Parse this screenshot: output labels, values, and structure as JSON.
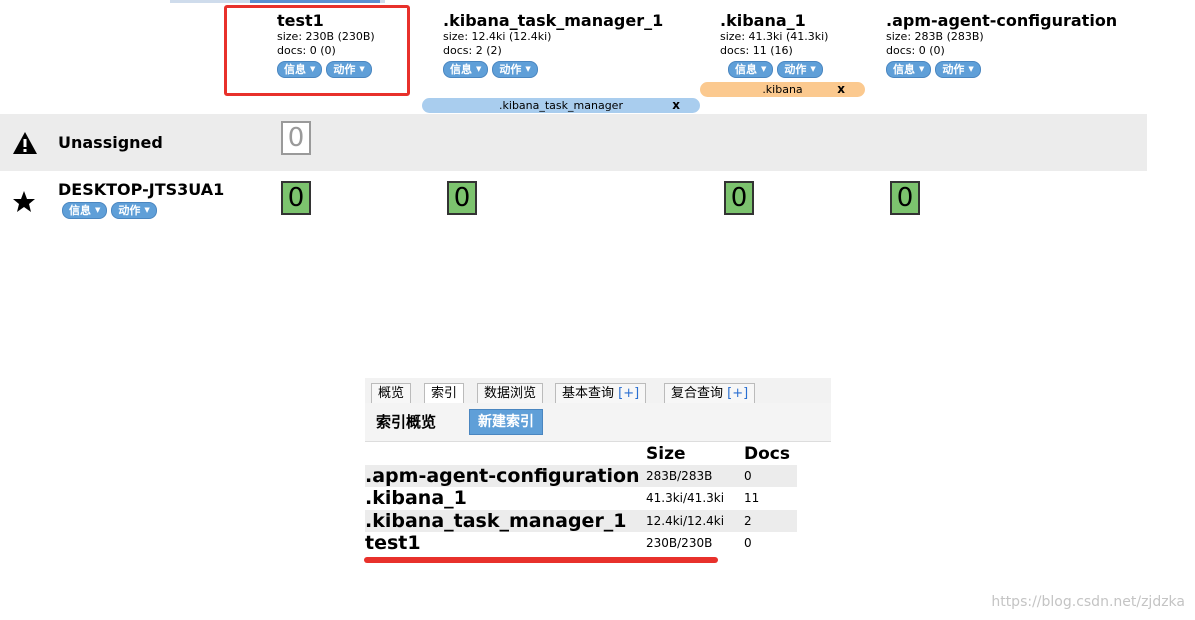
{
  "indices": [
    {
      "name": "test1",
      "size": "size: 230B (230B)",
      "docs": "docs: 0 (0)"
    },
    {
      "name": ".kibana_task_manager_1",
      "size": "size: 12.4ki (12.4ki)",
      "docs": "docs: 2 (2)"
    },
    {
      "name": ".kibana_1",
      "size": "size: 41.3ki (41.3ki)",
      "docs": "docs: 11 (16)"
    },
    {
      "name": ".apm-agent-configuration",
      "size": "size: 283B (283B)",
      "docs": "docs: 0 (0)"
    }
  ],
  "buttons": {
    "info": "信息",
    "action": "动作"
  },
  "aliases": [
    {
      "label": ".kibana_task_manager",
      "close": "x",
      "color": "#a9cdee"
    },
    {
      "label": ".kibana",
      "close": "x",
      "color": "#fbc98f"
    }
  ],
  "nodes": {
    "unassigned": {
      "label": "Unassigned",
      "shard": "0"
    },
    "desktop": {
      "label": "DESKTOP-JTS3UA1",
      "shards": [
        "0",
        "0",
        "0",
        "0"
      ]
    }
  },
  "panel": {
    "tabs": [
      {
        "label": "概览"
      },
      {
        "label": "索引"
      },
      {
        "label": "数据浏览"
      },
      {
        "label": "基本查询",
        "plus": "[+]"
      },
      {
        "label": "复合查询",
        "plus": "[+]"
      }
    ],
    "title": "索引概览",
    "new_button": "新建索引",
    "headers": {
      "size": "Size",
      "docs": "Docs"
    },
    "rows": [
      {
        "name": ".apm-agent-configuration",
        "size": "283B/283B",
        "docs": "0"
      },
      {
        "name": ".kibana_1",
        "size": "41.3ki/41.3ki",
        "docs": "11"
      },
      {
        "name": ".kibana_task_manager_1",
        "size": "12.4ki/12.4ki",
        "docs": "2"
      },
      {
        "name": "test1",
        "size": "230B/230B",
        "docs": "0"
      }
    ]
  },
  "watermark": "https://blog.csdn.net/zjdzka",
  "colors": {
    "accent": "#5f9fd8",
    "shard_ok": "#7cc36e",
    "highlight": "#e8312b"
  }
}
